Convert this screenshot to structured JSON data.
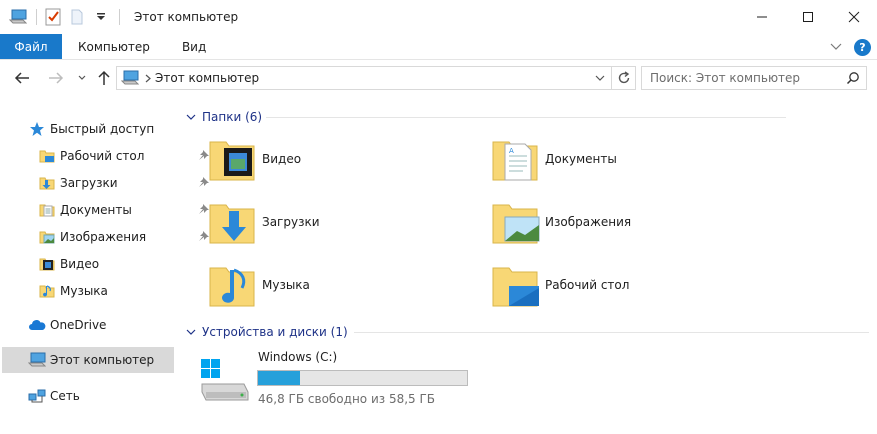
{
  "window": {
    "title": "Этот компьютер",
    "controls": [
      "minimize-icon",
      "maximize-icon",
      "close-icon"
    ]
  },
  "quick_access_toolbar": [
    "computer-icon",
    "properties-icon",
    "new-folder-icon",
    "qat-dropdown-icon"
  ],
  "ribbon": {
    "tabs": [
      "Файл",
      "Компьютер",
      "Вид"
    ],
    "active_tab": "Файл",
    "accent": "#1979ca"
  },
  "address_bar": {
    "path": "Этот компьютер",
    "search_placeholder": "Поиск: Этот компьютер"
  },
  "sidebar": {
    "quick_access": {
      "label": "Быстрый доступ",
      "items": [
        {
          "label": "Рабочий стол",
          "icon": "desktop-folder-icon",
          "pinned": true
        },
        {
          "label": "Загрузки",
          "icon": "downloads-folder-icon",
          "pinned": true
        },
        {
          "label": "Документы",
          "icon": "documents-folder-icon",
          "pinned": true
        },
        {
          "label": "Изображения",
          "icon": "pictures-folder-icon",
          "pinned": true
        },
        {
          "label": "Видео",
          "icon": "video-folder-icon",
          "pinned": false
        },
        {
          "label": "Музыка",
          "icon": "music-folder-icon",
          "pinned": false
        }
      ]
    },
    "onedrive": "OneDrive",
    "this_pc": "Этот компьютер",
    "network": "Сеть",
    "selected": "Этот компьютер"
  },
  "main": {
    "folders_header": "Папки (6)",
    "folders": [
      {
        "label": "Видео",
        "icon": "video-folder-icon"
      },
      {
        "label": "Документы",
        "icon": "documents-folder-icon"
      },
      {
        "label": "Загрузки",
        "icon": "downloads-folder-icon"
      },
      {
        "label": "Изображения",
        "icon": "pictures-folder-icon"
      },
      {
        "label": "Музыка",
        "icon": "music-folder-icon"
      },
      {
        "label": "Рабочий стол",
        "icon": "desktop-folder-icon"
      }
    ],
    "devices_header": "Устройства и диски (1)",
    "drives": [
      {
        "label": "Windows (C:)",
        "free_text": "46,8 ГБ свободно из 58,5 ГБ",
        "used_fraction": 0.2,
        "bar_color": "#26a0da"
      }
    ]
  }
}
